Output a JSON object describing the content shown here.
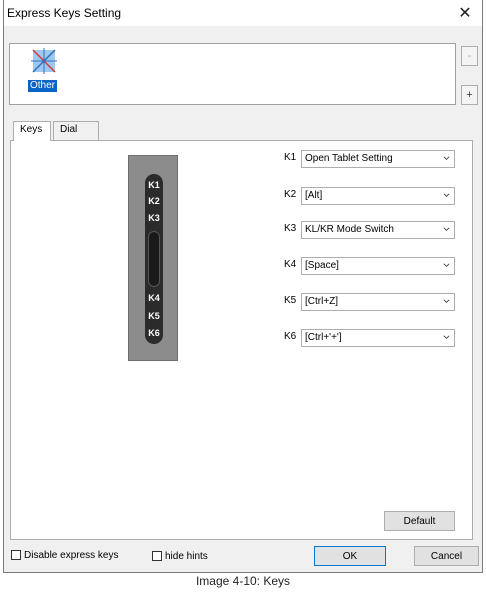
{
  "window": {
    "title": "Express Keys Setting",
    "close_glyph": "✕"
  },
  "app_list": {
    "items": [
      {
        "label": "Other",
        "icon": "app-icon",
        "selected": true
      }
    ]
  },
  "side_buttons": {
    "remove": "-",
    "add": "+"
  },
  "tabs": [
    {
      "label": "Keys",
      "active": true
    },
    {
      "label": "Dial",
      "active": false
    }
  ],
  "device": {
    "keys": [
      "K1",
      "K2",
      "K3",
      "K4",
      "K5",
      "K6"
    ]
  },
  "key_mappings": [
    {
      "key": "K1",
      "value": "Open Tablet Setting"
    },
    {
      "key": "K2",
      "value": "[Alt]"
    },
    {
      "key": "K3",
      "value": "KL/KR Mode Switch"
    },
    {
      "key": "K4",
      "value": "[Space]"
    },
    {
      "key": "K5",
      "value": "[Ctrl+Z]"
    },
    {
      "key": "K6",
      "value": "[Ctrl+'+']"
    }
  ],
  "buttons": {
    "default": "Default",
    "ok": "OK",
    "cancel": "Cancel"
  },
  "checkboxes": {
    "disable_express_keys": "Disable express keys",
    "hide_hints": "hide hints"
  },
  "caption": "Image 4-10: Keys",
  "colors": {
    "selection": "#0a64c8",
    "device_body": "#8c8c8c",
    "device_bar": "#2b2b2b",
    "ok_border": "#0078d7"
  }
}
